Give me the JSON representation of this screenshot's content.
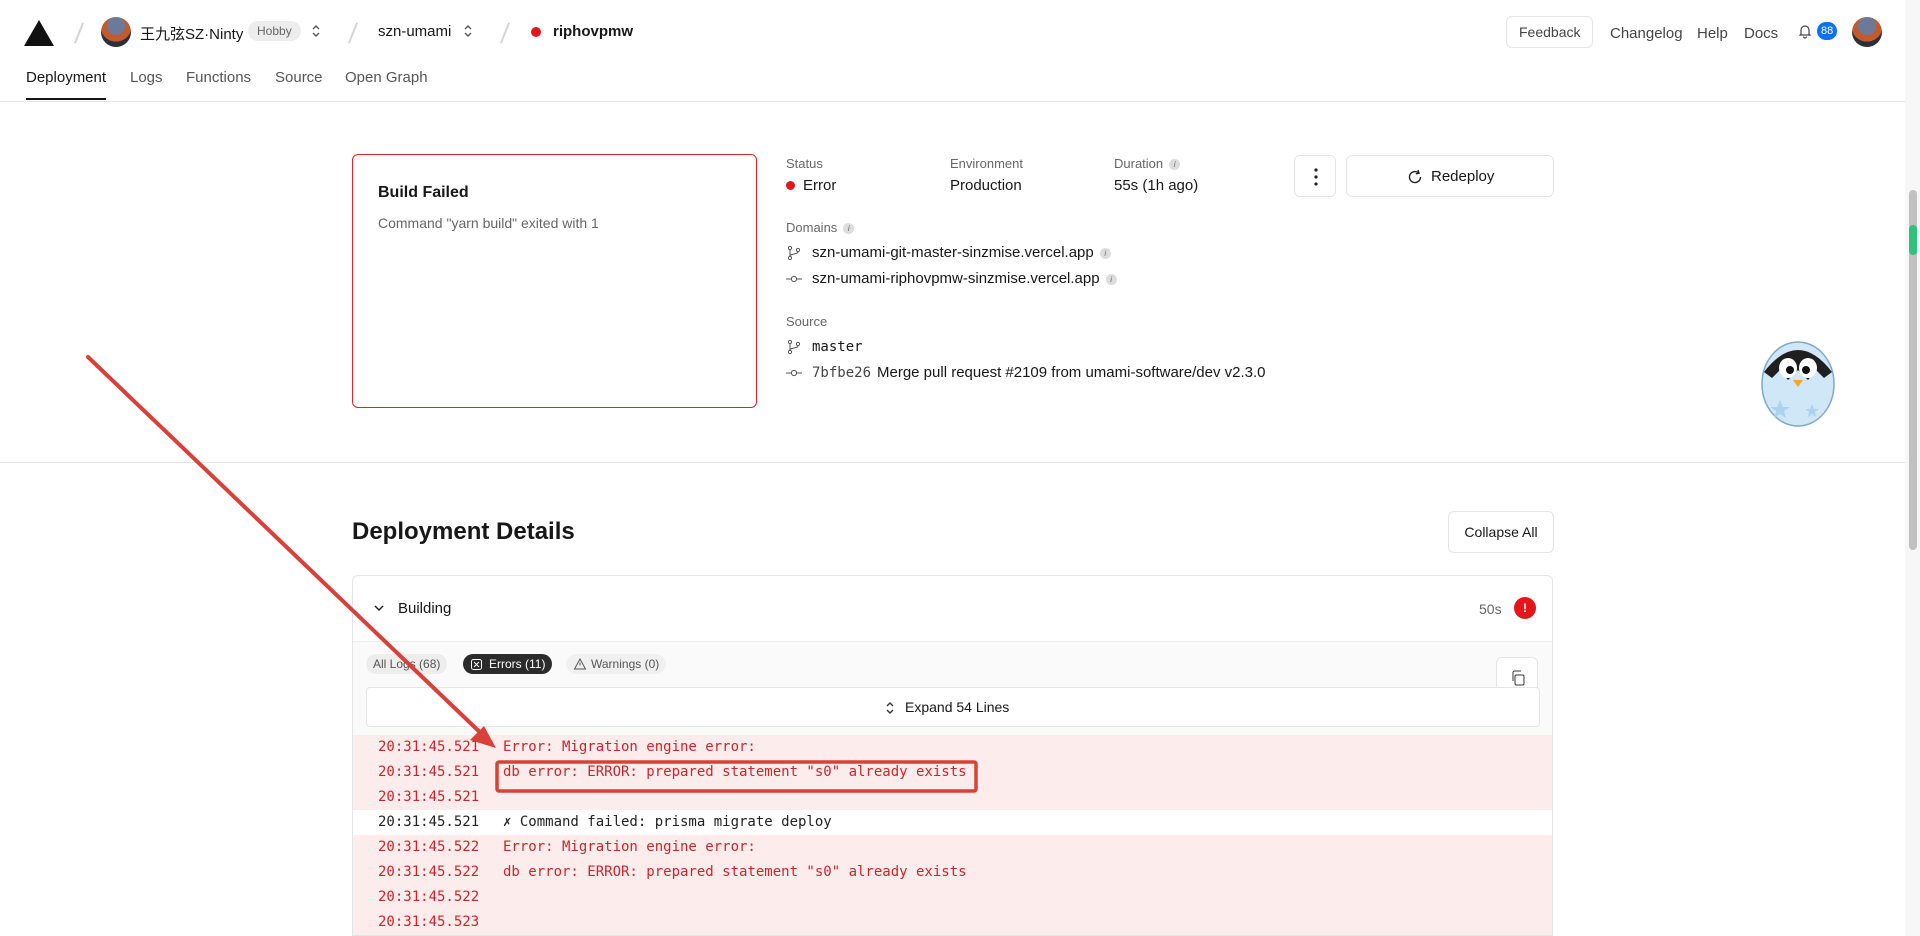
{
  "header": {
    "team_name": "王九弦SZ·Ninty",
    "plan_badge": "Hobby",
    "project_name": "szn-umami",
    "deployment_name": "riphovpmw",
    "feedback_label": "Feedback",
    "nav": [
      "Changelog",
      "Help",
      "Docs"
    ],
    "notification_count": "88"
  },
  "tabs": [
    "Deployment",
    "Logs",
    "Functions",
    "Source",
    "Open Graph"
  ],
  "build": {
    "title": "Build Failed",
    "message": "Command \"yarn build\" exited with 1"
  },
  "overview": {
    "status_label": "Status",
    "status_value": "Error",
    "status_color": "#e5161a",
    "environment_label": "Environment",
    "environment_value": "Production",
    "duration_label": "Duration",
    "duration_value": "55s (1h ago)",
    "domains_label": "Domains",
    "domains": [
      "szn-umami-git-master-sinzmise.vercel.app",
      "szn-umami-riphovpmw-sinzmise.vercel.app"
    ],
    "source_label": "Source",
    "branch": "master",
    "commit_hash": "7bfbe26",
    "commit_message": "Merge pull request #2109 from umami-software/dev v2.3.0",
    "redeploy_label": "Redeploy"
  },
  "details": {
    "title": "Deployment Details",
    "collapse_label": "Collapse All",
    "step_title": "Building",
    "step_duration": "50s",
    "filters": {
      "all": "All Logs (68)",
      "errors": "Errors (11)",
      "warnings": "Warnings (0)"
    },
    "expand_label": "Expand 54 Lines",
    "logs": [
      {
        "ts": "20:31:45.521",
        "msg": "Error: Migration engine error:",
        "level": "error"
      },
      {
        "ts": "20:31:45.521",
        "msg": "db error: ERROR: prepared statement \"s0\" already exists",
        "level": "error"
      },
      {
        "ts": "20:31:45.521",
        "msg": "",
        "level": "error"
      },
      {
        "ts": "20:31:45.521",
        "msg": "✗ Command failed: prisma migrate deploy",
        "level": "normal"
      },
      {
        "ts": "20:31:45.522",
        "msg": "Error: Migration engine error:",
        "level": "error"
      },
      {
        "ts": "20:31:45.522",
        "msg": "db error: ERROR: prepared statement \"s0\" already exists",
        "level": "error"
      },
      {
        "ts": "20:31:45.522",
        "msg": "",
        "level": "error"
      },
      {
        "ts": "20:31:45.523",
        "msg": "",
        "level": "error"
      }
    ]
  },
  "annotation_color": "#d9403a"
}
